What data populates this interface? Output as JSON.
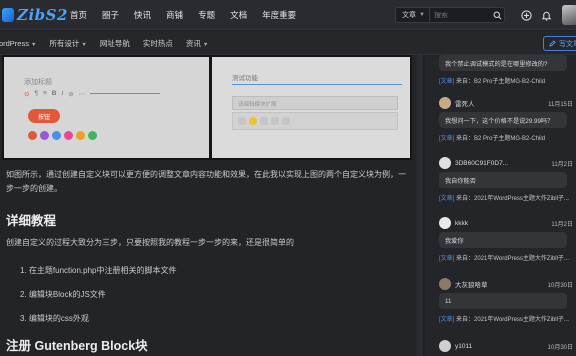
{
  "logo": {
    "text": "ZibS2"
  },
  "nav": [
    "首页",
    "圈子",
    "快讯",
    "商铺",
    "专题",
    "文档",
    "年度重要"
  ],
  "search": {
    "type_label": "文章",
    "placeholder": "搜索"
  },
  "subnav": [
    {
      "label": "WordPress",
      "has_caret": true
    },
    {
      "label": "所有设计",
      "has_caret": true
    },
    {
      "label": "网址导航",
      "has_caret": false
    },
    {
      "label": "实时热点",
      "has_caret": false
    },
    {
      "label": "资讯",
      "has_caret": true
    }
  ],
  "write_button": "写文章",
  "article": {
    "screenshot": {
      "left_title": "添加标题",
      "left_button": "按钮",
      "right_title": "测试功能",
      "right_placeholder": "请编辑模块扩展"
    },
    "paragraph1": "如图所示，通过创建自定义块可以更方便的调整文章内容功能和效果，在此我以实现上图的两个自定义块为例，一步一步的创建。",
    "heading1": "详细教程",
    "paragraph2": "创建自定义的过程大致分为三步，只要按照我的教程一步一步的来，还是很简单的",
    "steps": [
      "1. 在主题function.php中注册相关的脚本文件",
      "2. 编辑块Block的JS文件",
      "3. 编辑块的css外观"
    ],
    "heading2": "注册 Gutenberg Block块"
  },
  "comments": [
    {
      "name": "",
      "time": "",
      "content": "我个禁止调试模式的是在哪里修改的?",
      "source_tag": "[文章]",
      "source": "来自：B2 Pro子主题MG-B2-Child",
      "avatar_color": "#777777",
      "show_head": false
    },
    {
      "name": "雷死人",
      "time": "11月15日",
      "content": "我想问一下，这个价格不是说29.99吗？",
      "source_tag": "[文章]",
      "source": "来自：B2 Pro子主题MG-B2-Child",
      "avatar_color": "#c9a98a",
      "show_head": true
    },
    {
      "name": "3DB60C91F0D7...",
      "time": "11月2日",
      "content": "我自你能否",
      "source_tag": "[文章]",
      "source": "来自：2021年WordPress主题大作Zibll子...",
      "avatar_color": "#e0e0e0",
      "show_head": true
    },
    {
      "name": "kkkk",
      "time": "11月2日",
      "content": "我爱你",
      "source_tag": "[文章]",
      "source": "来自：2021年WordPress主题大作Zibll子...",
      "avatar_color": "#e9e9e9",
      "show_head": true
    },
    {
      "name": "大灰狼哈草",
      "time": "10月30日",
      "content": "11",
      "source_tag": "[文章]",
      "source": "来自：2021年WordPress主题大作Zibll子...",
      "avatar_color": "#8a7a6a",
      "show_head": true
    },
    {
      "name": "y1011",
      "time": "10月30日",
      "content": "",
      "source_tag": "",
      "source": "",
      "avatar_color": "#cfcfcf",
      "show_head": true
    }
  ],
  "colors": {
    "accent": "#4a8fe8",
    "background": "#1f2024",
    "panel": "#242529",
    "bubble": "#343539"
  },
  "icons": [
    "search-icon",
    "plus-circle-icon",
    "bell-icon",
    "pencil-icon"
  ]
}
